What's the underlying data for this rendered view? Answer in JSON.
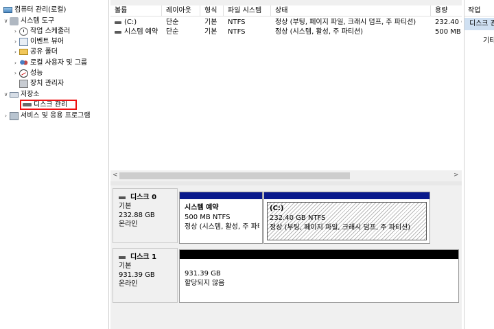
{
  "tree": {
    "root": "컴퓨터 관리(로컬)",
    "system_tools": "시스템 도구",
    "task_scheduler": "작업 스케줄러",
    "event_viewer": "이벤트 뷰어",
    "shared_folders": "공유 폴더",
    "local_users": "로컬 사용자 및 그룹",
    "performance": "성능",
    "device_manager": "장치 관리자",
    "storage": "저장소",
    "disk_management": "디스크 관리",
    "services_apps": "서비스 및 응용 프로그램",
    "expander_open": "∨",
    "expander_closed": "›"
  },
  "volumes": {
    "columns": [
      "볼륨",
      "레이아웃",
      "형식",
      "파일 시스템",
      "상태",
      "용량"
    ],
    "rows": [
      {
        "volume": "(C:)",
        "layout": "단순",
        "type": "기본",
        "fs": "NTFS",
        "status": "정상 (부팅, 페이지 파일, 크래시 덤프, 주 파티션)",
        "capacity": "232.40 GB"
      },
      {
        "volume": "시스템 예약",
        "layout": "단순",
        "type": "기본",
        "fs": "NTFS",
        "status": "정상 (시스템, 활성, 주 파티션)",
        "capacity": "500 MB"
      }
    ]
  },
  "scroll": {
    "left_arrow": "<",
    "right_arrow": ">"
  },
  "disks": [
    {
      "name": "디스크 0",
      "type": "기본",
      "size": "232.88 GB",
      "state": "온라인",
      "partitions": [
        {
          "title": "시스템 예약",
          "size_fs": "500 MB NTFS",
          "status": "정상 (시스템, 활성, 주 파티션)"
        },
        {
          "title": "(C:)",
          "size_fs": "232.40 GB NTFS",
          "status": "정상 (부팅, 페이지 파일, 크래시 덤프, 주 파티션)"
        }
      ]
    },
    {
      "name": "디스크 1",
      "type": "기본",
      "size": "931.39 GB",
      "state": "온라인",
      "partitions": [
        {
          "size": "931.39 GB",
          "status": "할당되지 않음"
        }
      ]
    }
  ],
  "actions": {
    "title": "작업",
    "disk_management": "디스크 관리",
    "more": "기타 작업"
  },
  "colors": {
    "primary_partition_bar": "#0a1a8c",
    "unallocated_bar": "#000000",
    "selection_box": "#ee1111",
    "actions_highlight": "#cfe0f2"
  }
}
